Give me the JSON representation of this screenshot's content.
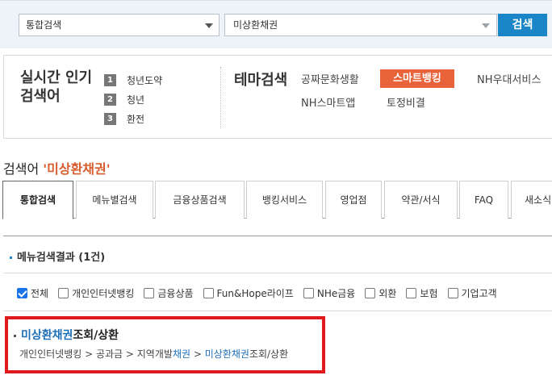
{
  "search": {
    "scope_value": "통합검색",
    "query_value": "미상환채권",
    "button_label": "검색"
  },
  "popular": {
    "title_line1": "실시간 인기",
    "title_line2": "검색어",
    "items": [
      {
        "rank": "1",
        "text": "청년도약"
      },
      {
        "rank": "2",
        "text": "청년"
      },
      {
        "rank": "3",
        "text": "환전"
      }
    ]
  },
  "theme": {
    "title": "테마검색",
    "items": [
      "공짜문화생활",
      "스마트뱅킹",
      "NH우대서비스",
      "NH스마트앱",
      "토정비결"
    ]
  },
  "keyword": {
    "prefix": "검색어 ",
    "value": "'미상환채권'"
  },
  "tabs": [
    "통합검색",
    "메뉴별검색",
    "금융상품검색",
    "뱅킹서비스",
    "영업점",
    "약관/서식",
    "FAQ",
    "새소식"
  ],
  "results": {
    "menu_title": "메뉴검색결과 (1건)",
    "filters": [
      {
        "label": "전체",
        "checked": true
      },
      {
        "label": "개인인터넷뱅킹",
        "checked": false
      },
      {
        "label": "금융상품",
        "checked": false
      },
      {
        "label": "Fun&Hope라이프",
        "checked": false
      },
      {
        "label": "NHe금융",
        "checked": false
      },
      {
        "label": "외환",
        "checked": false
      },
      {
        "label": "보험",
        "checked": false
      },
      {
        "label": "기업고객",
        "checked": false
      }
    ],
    "hit": {
      "title_highlight": "미상환채권",
      "title_rest": "조회/상환",
      "path_part1": "개인인터넷뱅킹 > 공과금 > 지역개발",
      "path_blue1": "채권",
      "path_part2": " > ",
      "path_blue2": "미상환채권",
      "path_part3": "조회/상환"
    }
  },
  "colors": {
    "accent_blue": "#1a86c8",
    "theme_active": "#e8623a",
    "highlight_box": "#e0191c"
  }
}
